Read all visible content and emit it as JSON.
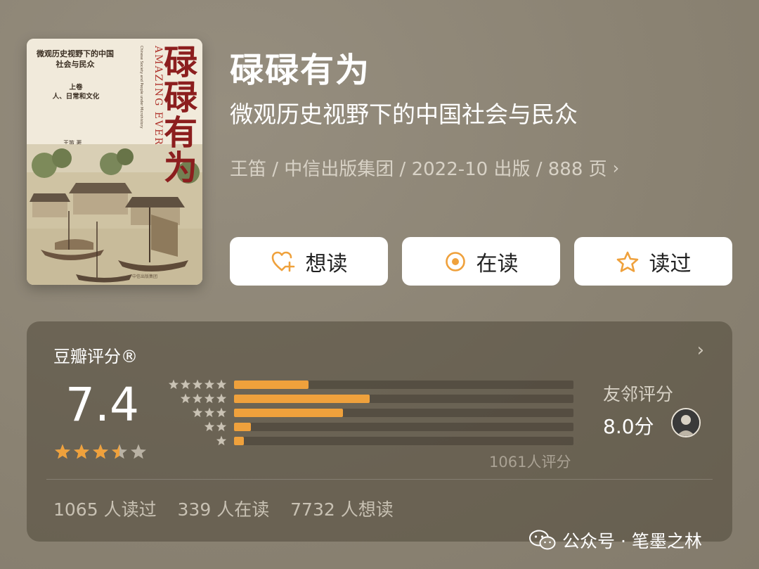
{
  "book": {
    "title": "碌碌有为",
    "subtitle": "微观历史视野下的中国社会与民众",
    "meta": "王笛 / 中信出版集团 / 2022-10 出版 / 888 页",
    "cover": {
      "title": "碌碌有为",
      "subtitle": "微观历史视野下的中国社会与民众",
      "volume_line1": "上卷",
      "volume_line2": "人、日常和文化",
      "author": "王笛 著",
      "english_title": "AMAZING EVERYDAY SUCCESSES",
      "english_sub": "Chinese Society and People under Microhistory",
      "publisher": "中信出版集团"
    }
  },
  "actions": {
    "want": "想读",
    "reading": "在读",
    "read": "读过"
  },
  "rating": {
    "header": "豆瓣评分®",
    "score": "7.4",
    "stars": 3.5,
    "count_label": "1061人评分",
    "distribution": [
      {
        "stars": 5,
        "fraction": 0.22
      },
      {
        "stars": 4,
        "fraction": 0.4
      },
      {
        "stars": 3,
        "fraction": 0.32
      },
      {
        "stars": 2,
        "fraction": 0.05
      },
      {
        "stars": 1,
        "fraction": 0.03
      }
    ],
    "friends_label": "友邻评分",
    "friends_score": "8.0分",
    "stats": {
      "read": "1065 人读过",
      "reading": "339 人在读",
      "want": "7732 人想读"
    }
  },
  "watermark": "公众号 · 笔墨之林",
  "colors": {
    "accent": "#efa13c",
    "background": "#8f8777",
    "title_red": "#8c1e1e"
  }
}
